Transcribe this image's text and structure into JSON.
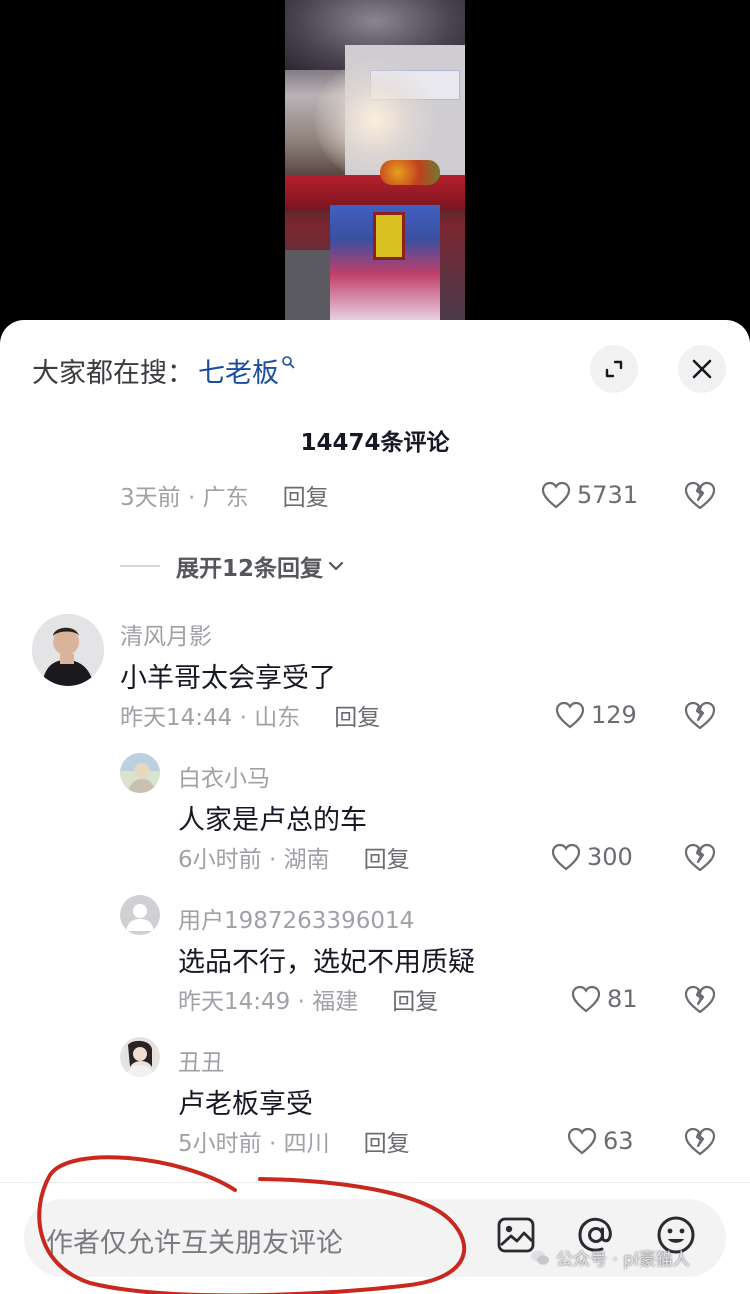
{
  "search": {
    "label": "大家都在搜：",
    "term": "七老板"
  },
  "comments_header": {
    "count_text": "14474条评论"
  },
  "top_meta": {
    "time_location": "3天前 · 广东",
    "reply_label": "回复",
    "likes": "5731"
  },
  "expand": {
    "label": "展开12条回复"
  },
  "comments": [
    {
      "username": "清风月影",
      "text": "小羊哥太会享受了",
      "time_location": "昨天14:44 · 山东",
      "reply_label": "回复",
      "likes": "129"
    },
    {
      "username": "白衣小马",
      "text": "人家是卢总的车",
      "time_location": "6小时前 · 湖南",
      "reply_label": "回复",
      "likes": "300"
    },
    {
      "username": "用户1987263396014",
      "text": "选品不行，选妃不用质疑",
      "time_location": "昨天14:49 · 福建",
      "reply_label": "回复",
      "likes": "81"
    },
    {
      "username": "丑丑",
      "text": "卢老板享受",
      "time_location": "5小时前 · 四川",
      "reply_label": "回复",
      "likes": "63"
    }
  ],
  "input": {
    "placeholder": "作者仅允许互关朋友评论"
  },
  "watermark": {
    "text": "公众号 · pl豪猫人"
  },
  "icons": {
    "expand": "expand-icon",
    "close": "close-icon",
    "like": "heart-icon",
    "dislike": "broken-heart-icon",
    "image": "image-icon",
    "mention": "at-icon",
    "emoji": "emoji-icon"
  },
  "colors": {
    "search_term": "#1a4fa0",
    "annotation": "#c8281e"
  }
}
